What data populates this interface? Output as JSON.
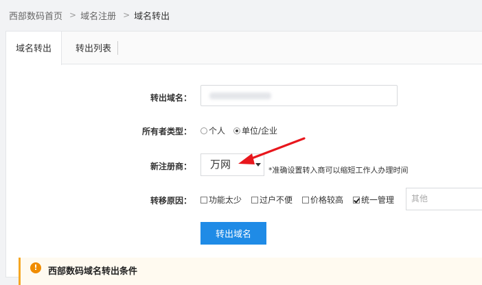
{
  "breadcrumb": {
    "home": "西部数码首页",
    "domain_reg": "域名注册",
    "current": "域名转出",
    "separator": ">"
  },
  "tabs": [
    "域名转出",
    "转出列表"
  ],
  "form": {
    "domain_label": "转出域名：",
    "owner_label": "所有者类型：",
    "owner_options": [
      "个人",
      "单位/企业"
    ],
    "owner_selected": "单位/企业",
    "registrar_label": "新注册商：",
    "registrar_value": "万网",
    "registrar_hint": "*准确设置转入商可以缩短工作人办理时间",
    "reason_label": "转移原因：",
    "reasons": [
      {
        "label": "功能太少",
        "checked": false
      },
      {
        "label": "过户不便",
        "checked": false
      },
      {
        "label": "价格较高",
        "checked": false
      },
      {
        "label": "统一管理",
        "checked": true
      }
    ],
    "other_placeholder": "其他",
    "submit_label": "转出域名"
  },
  "notice": {
    "title": "西部数码域名转出条件",
    "icon": "!"
  },
  "colors": {
    "primary": "#1f8be6",
    "warning": "#f08c00",
    "arrow": "#e8171d"
  }
}
